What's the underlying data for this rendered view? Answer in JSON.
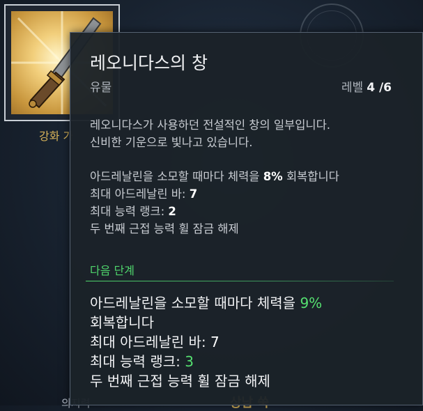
{
  "item": {
    "caption": "강화 가",
    "icon": "spear-relic-icon"
  },
  "background": {
    "bottom_text": "의지력",
    "bottom_gold": "상남 쑥"
  },
  "tooltip": {
    "title": "레오니다스의 창",
    "category": "유물",
    "level_label": "레벨",
    "level_value": "4 /6",
    "description": [
      "레오니다스가 사용하던 전설적인 창의 일부입니다.",
      "신비한 기운으로 빛나고 있습니다."
    ],
    "current": {
      "line1_prefix": "아드레날린을 소모할 때마다 체력을 ",
      "line1_value": "8%",
      "line1_suffix": " 회복합니다",
      "line2_prefix": "최대 아드레날린 바: ",
      "line2_value": "7",
      "line3_prefix": "최대 능력 랭크: ",
      "line3_value": "2",
      "line4": "두 번째 근접 능력 휠 잠금 해제"
    },
    "next_stage_label": "다음 단계",
    "next": {
      "line1_prefix": "아드레날린을 소모할 때마다 체력을 ",
      "line1_value": "9%",
      "line2": "회복합니다",
      "line3_prefix": "최대 아드레날린 바: ",
      "line3_value": "7",
      "line4_prefix": "최대 능력 랭크: ",
      "line4_value": "3",
      "line5": "두 번째 근접 능력 휠 잠금 해제"
    },
    "colors": {
      "accent_green": "#55e070",
      "gold": "#d9b45a"
    }
  }
}
